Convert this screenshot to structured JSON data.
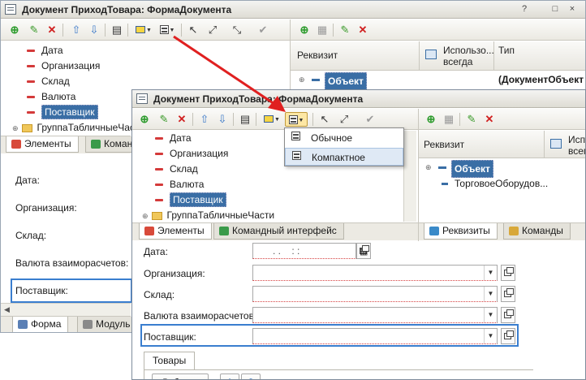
{
  "back_window": {
    "title": "Документ ПриходТовара: ФормаДокумента",
    "tree_items": [
      "Дата",
      "Организация",
      "Склад",
      "Валюта",
      "Поставщик"
    ],
    "tree_group": "ГруппаТабличныеЧасти",
    "tabs": [
      "Элементы",
      "Команд"
    ],
    "bottom_tabs": [
      "Форма",
      "Модуль"
    ],
    "grid_headers": {
      "col1": "Реквизит",
      "col2": "Использо... всегда",
      "col3": "Тип"
    },
    "grid_row": {
      "name": "Объект",
      "type": "(ДокументОбъект"
    },
    "form_labels": [
      "Дата:",
      "Организация:",
      "Склад:",
      "Валюта взаиморасчетов:",
      "Поставщик:"
    ]
  },
  "front_window": {
    "title": "Документ ПриходТовара: ФормаДокумента",
    "tree_items": [
      "Дата",
      "Организация",
      "Склад",
      "Валюта",
      "Поставщик"
    ],
    "tree_group": "ГруппаТабличныеЧасти",
    "tabs": [
      "Элементы",
      "Командный интерфейс"
    ],
    "right_tabs": [
      "Реквизиты",
      "Команды"
    ],
    "grid_headers": {
      "col1": "Реквизит",
      "col2": "Испо всег"
    },
    "grid_rows": [
      "Объект",
      "ТорговоеОборудов..."
    ],
    "form": {
      "date_label": "Дата:",
      "date_value": ". .    : :",
      "org_label": "Организация:",
      "warehouse_label": "Склад:",
      "currency_label": "Валюта взаиморасчетов:",
      "supplier_label": "Поставщик:"
    },
    "group_tab": "Товары",
    "add_button": "Добавит"
  },
  "popup_menu": {
    "items": [
      "Обычное",
      "Компактное"
    ],
    "hovered": "Компактное"
  },
  "colors": {
    "selection": "#3a6ea5",
    "focus": "#3a7ecf",
    "arrow": "#e02020"
  }
}
